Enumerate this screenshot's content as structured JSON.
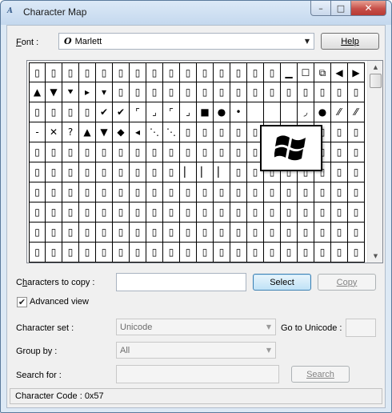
{
  "window": {
    "title": "Character Map",
    "app_icon": "A",
    "controls": {
      "minimize": "–",
      "maximize": "□",
      "close": "✕"
    }
  },
  "font": {
    "label": "Font :",
    "value": "Marlett",
    "icon": "O"
  },
  "help_button": "Help",
  "grid": {
    "rows": [
      [
        "▯",
        "▯",
        "▯",
        "▯",
        "▯",
        "▯",
        "▯",
        "▯",
        "▯",
        "▯",
        "▯",
        "▯",
        "▯",
        "▯",
        "▯",
        "▁",
        "☐",
        "⧉",
        "◀",
        "▶"
      ],
      [
        "▲",
        "▼",
        "⯆",
        "▸",
        "▾",
        "▯",
        "▯",
        "▯",
        "▯",
        "▯",
        "▯",
        "▯",
        "▯",
        "▯",
        "▯",
        "▯",
        "▯",
        "▯",
        "▯",
        "▯"
      ],
      [
        "▯",
        "▯",
        "▯",
        "▯",
        "✔",
        "✔",
        "⌜",
        "⌟",
        "⌜",
        "⌟",
        "■",
        "●",
        "•",
        "",
        "",
        "",
        "◞",
        "●",
        "⁄⁄",
        "⁄⁄"
      ],
      [
        "-",
        "✕",
        "?",
        "▲",
        "▼",
        "◆",
        "◂",
        "⋱",
        "⋱",
        "▯",
        "▯",
        "▯",
        "▯",
        "▯",
        "▯",
        "▯",
        "▯",
        "▯",
        "▯",
        "▯"
      ],
      [
        "▯",
        "▯",
        "▯",
        "▯",
        "▯",
        "▯",
        "▯",
        "▯",
        "▯",
        "▯",
        "▯",
        "▯",
        "▯",
        "▯",
        "▯",
        "▯",
        "▯",
        "▯",
        "▯",
        "▯"
      ],
      [
        "▯",
        "▯",
        "▯",
        "▯",
        "▯",
        "▯",
        "▯",
        "▯",
        "▯",
        "▏",
        "▏",
        "▏",
        "▯",
        "▯",
        "▯",
        "▯",
        "▯",
        "▯",
        "▯",
        "▯"
      ],
      [
        "▯",
        "▯",
        "▯",
        "▯",
        "▯",
        "▯",
        "▯",
        "▯",
        "▯",
        "▯",
        "▯",
        "▯",
        "▯",
        "▯",
        "▯",
        "▯",
        "▯",
        "▯",
        "▯",
        "▯"
      ],
      [
        "▯",
        "▯",
        "▯",
        "▯",
        "▯",
        "▯",
        "▯",
        "▯",
        "▯",
        "▯",
        "▯",
        "▯",
        "▯",
        "▯",
        "▯",
        "▯",
        "▯",
        "▯",
        "▯",
        "▯"
      ],
      [
        "▯",
        "▯",
        "▯",
        "▯",
        "▯",
        "▯",
        "▯",
        "▯",
        "▯",
        "▯",
        "▯",
        "▯",
        "▯",
        "▯",
        "▯",
        "▯",
        "▯",
        "▯",
        "▯",
        "▯"
      ],
      [
        "▯",
        "▯",
        "▯",
        "▯",
        "▯",
        "▯",
        "▯",
        "▯",
        "▯",
        "▯",
        "▯",
        "▯",
        "▯",
        "▯",
        "▯",
        "▯",
        "▯",
        "▯",
        "▯",
        "▯"
      ]
    ],
    "selected_glyph": "windows-logo-icon"
  },
  "copy": {
    "label": "Characters to copy :",
    "value": "",
    "select_button": "Select",
    "copy_button": "Copy"
  },
  "advanced_view": {
    "label": "Advanced view",
    "checked": true,
    "check_mark": "✔"
  },
  "character_set": {
    "label": "Character set :",
    "value": "Unicode"
  },
  "go_to_unicode": {
    "label": "Go to Unicode :",
    "value": ""
  },
  "group_by": {
    "label": "Group by :",
    "value": "All"
  },
  "search": {
    "label": "Search for :",
    "value": "",
    "button": "Search"
  },
  "status": {
    "text": "Character Code : 0x57"
  },
  "colors": {
    "title_bg": "#dce9f7",
    "client_bg": "#f0f0f0",
    "close_red": "#c75049",
    "accent": "#3c7fb1"
  },
  "dropdown_arrow": "▼",
  "scroll": {
    "up": "▲",
    "down": "▼"
  }
}
